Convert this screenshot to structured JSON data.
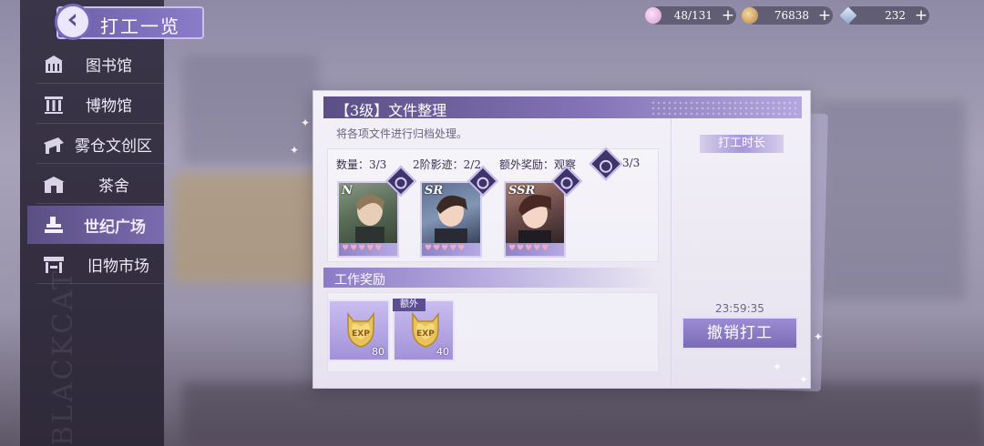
{
  "header": {
    "title": "打工一览"
  },
  "resources": [
    {
      "name": "energy",
      "value": "48/131",
      "icon": "pink-gem-icon",
      "color": "#e7b6e3"
    },
    {
      "name": "coins",
      "value": "76838",
      "icon": "coin-icon",
      "color": "#d7a764"
    },
    {
      "name": "crystals",
      "value": "232",
      "icon": "crystal-icon",
      "color": "#a6b8d9"
    }
  ],
  "sidebar": {
    "items": [
      {
        "label": "图书馆",
        "icon": "library-icon"
      },
      {
        "label": "博物馆",
        "icon": "museum-icon"
      },
      {
        "label": "雾仓文创区",
        "icon": "creative-district-icon"
      },
      {
        "label": "茶舍",
        "icon": "teahouse-icon"
      },
      {
        "label": "世纪广场",
        "icon": "plaza-icon",
        "active": true
      },
      {
        "label": "旧物市场",
        "icon": "market-icon"
      }
    ]
  },
  "job": {
    "title": "【3级】文件整理",
    "description": "将各项文件进行归档处理。",
    "quantity": "数量：3/3",
    "second_stage": "2阶影迹：2/2",
    "extra_reward": "额外奖励：观察",
    "extra_count": "3/3",
    "cards": [
      {
        "rarity": "N",
        "hearts": "♥♥♥♥♥"
      },
      {
        "rarity": "SR",
        "hearts": "♥♥♥♥♥"
      },
      {
        "rarity": "SSR",
        "hearts": "♥♥♥♥♥"
      }
    ]
  },
  "rewards": {
    "title": "工作奖励",
    "extra_tag": "额外",
    "items": [
      {
        "label": "EXP",
        "count": "80"
      },
      {
        "label": "EXP",
        "count": "40"
      }
    ]
  },
  "side": {
    "duration_label": "打工时长",
    "timer": "23:59:35",
    "cancel_label": "撤销打工"
  }
}
